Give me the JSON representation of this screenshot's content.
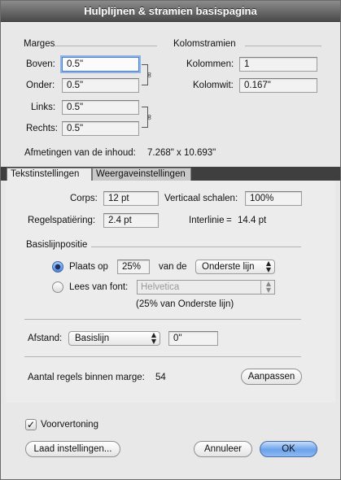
{
  "window": {
    "title": "Hulplijnen & stramien basispagina"
  },
  "margins": {
    "group_title": "Marges",
    "top_label": "Boven:",
    "top_value": "0.5\"",
    "bottom_label": "Onder:",
    "bottom_value": "0.5\"",
    "left_label": "Links:",
    "left_value": "0.5\"",
    "right_label": "Rechts:",
    "right_value": "0.5\""
  },
  "column_grid": {
    "group_title": "Kolomstramien",
    "columns_label": "Kolommen:",
    "columns_value": "1",
    "gutter_label": "Kolomwit:",
    "gutter_value": "0.167\""
  },
  "content_size": {
    "label": "Afmetingen van de inhoud:",
    "value": "7.268\" x 10.693\""
  },
  "tabs": [
    {
      "label": "Tekstinstellingen",
      "active": true
    },
    {
      "label": "Weergaveinstellingen",
      "active": false
    }
  ],
  "text_settings": {
    "size_label": "Corps:",
    "size_value": "12 pt",
    "vscale_label": "Verticaal schalen:",
    "vscale_value": "100%",
    "leading_label": "Regelspatiëring:",
    "leading_value": "2.4 pt",
    "interline_label": "Interlinie",
    "interline_eq": "=",
    "interline_value": "14.4 pt"
  },
  "baseline": {
    "group_title": "Basislijnpositie",
    "place_label": "Plaats op",
    "place_value": "25%",
    "of_label": "van de",
    "of_select": "Onderste lijn",
    "read_label": "Lees van font:",
    "font_select": "Helvetica",
    "note": "(25% van Onderste lijn)",
    "selected": "place"
  },
  "spacing": {
    "label": "Afstand:",
    "select": "Basislijn",
    "value": "0\""
  },
  "lines": {
    "label": "Aantal regels binnen marge:",
    "value": "54",
    "adjust_button": "Aanpassen"
  },
  "preview": {
    "label": "Voorvertoning",
    "checked": true
  },
  "buttons": {
    "load": "Laad instellingen...",
    "cancel": "Annuleer",
    "ok": "OK"
  },
  "icons": {
    "chain": "chain-link-icon",
    "check": "checkmark-icon",
    "popup": "popup-arrows-icon"
  }
}
